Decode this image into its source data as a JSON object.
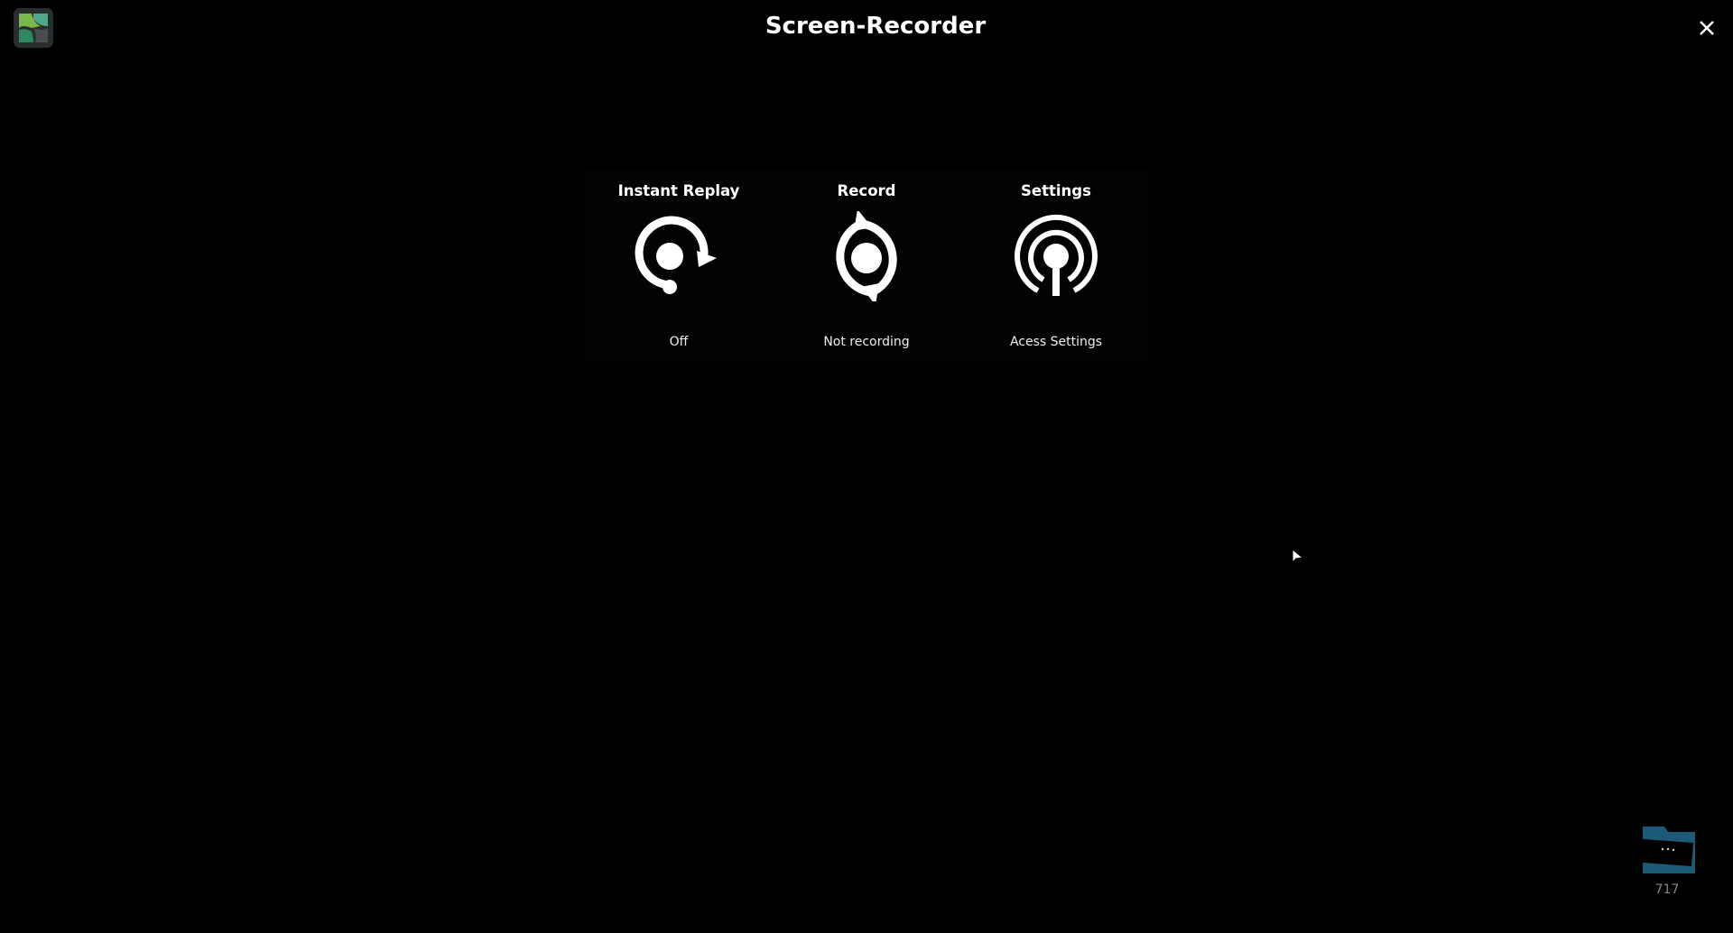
{
  "window": {
    "title": "Screen-Recorder",
    "app_icon": "pinwheel-logo",
    "close_icon": "close-icon"
  },
  "panel": {
    "items": [
      {
        "label": "Instant Replay",
        "status": "Off",
        "icon": "instant-replay-icon"
      },
      {
        "label": "Record",
        "status": "Not recording",
        "icon": "record-icon"
      },
      {
        "label": "Settings",
        "status": "Acess Settings",
        "icon": "settings-broadcast-icon"
      }
    ]
  },
  "folder": {
    "icon": "folder-icon",
    "count": "717",
    "color": "#1d5a78"
  }
}
